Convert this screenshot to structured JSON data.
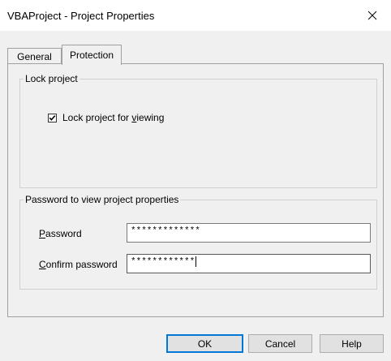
{
  "window": {
    "title": "VBAProject - Project Properties",
    "close_icon": "close-icon"
  },
  "tabs": [
    {
      "label": "General",
      "active": false
    },
    {
      "label": "Protection",
      "active": true
    }
  ],
  "lock_group": {
    "legend": "Lock project",
    "checkbox": {
      "label_prefix": "Lock project for ",
      "label_mnemonic": "v",
      "label_suffix": "iewing",
      "checked": true
    }
  },
  "password_group": {
    "legend": "Password to view project properties",
    "password": {
      "label_mnemonic": "P",
      "label_rest": "assword",
      "value": "*************"
    },
    "confirm": {
      "label_mnemonic": "C",
      "label_rest": "onfirm password",
      "value": "************"
    }
  },
  "buttons": {
    "ok": "OK",
    "cancel": "Cancel",
    "help": "Help"
  },
  "colors": {
    "focus_border": "#0078d7",
    "dialog_bg": "#f0f0f0"
  }
}
